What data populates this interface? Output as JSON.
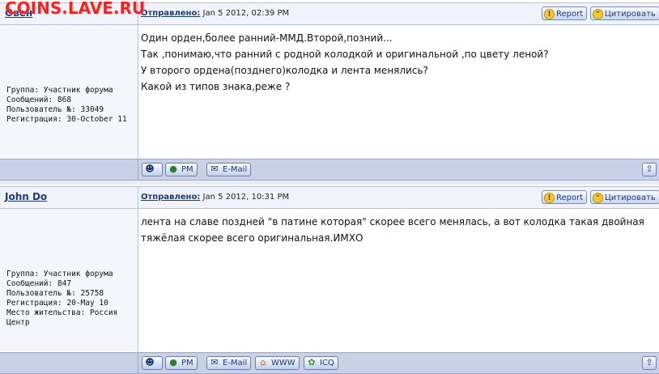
{
  "watermark": "COINS.LAVE.RU",
  "posts": [
    {
      "author": "Овен",
      "sent_label": "Отправлено:",
      "sent_date": "Jan 5 2012, 02:39 PM",
      "report_label": "Report",
      "quote_label": "Цитировать",
      "info": [
        "Группа: Участник форума",
        "Сообщений: 868",
        "Пользователь №: 33049",
        "Регистрация: 30-October 11"
      ],
      "message": [
        "Один орден,более ранний-ММД.Второй,позний...",
        "Так ,понимаю,что ранний с родной колодкой и оригинальной ,по цвету леной?",
        "У второго ордена(позднего)колодка и лента менялись?",
        "Какой из типов знака,реже ?"
      ],
      "footer": {
        "pm": "PM",
        "email": "E-Mail"
      }
    },
    {
      "author": "John Do",
      "sent_label": "Отправлено:",
      "sent_date": "Jan 5 2012, 10:31 PM",
      "report_label": "Report",
      "quote_label": "Цитировать",
      "info": [
        "Группа: Участник форума",
        "Сообщений: 847",
        "Пользователь №: 25758",
        "Регистрация: 20-May 10",
        "Место жительства: Россия",
        "Центр"
      ],
      "message": [
        "лента на славе поздней \"в патине которая\" скорее всего менялась, а вот колодка такая двойная",
        "тяжёлая скорее всего оригинальная.ИМХО"
      ],
      "footer": {
        "pm": "PM",
        "email": "E-Mail",
        "www": "WWW",
        "icq": "ICQ"
      }
    }
  ]
}
